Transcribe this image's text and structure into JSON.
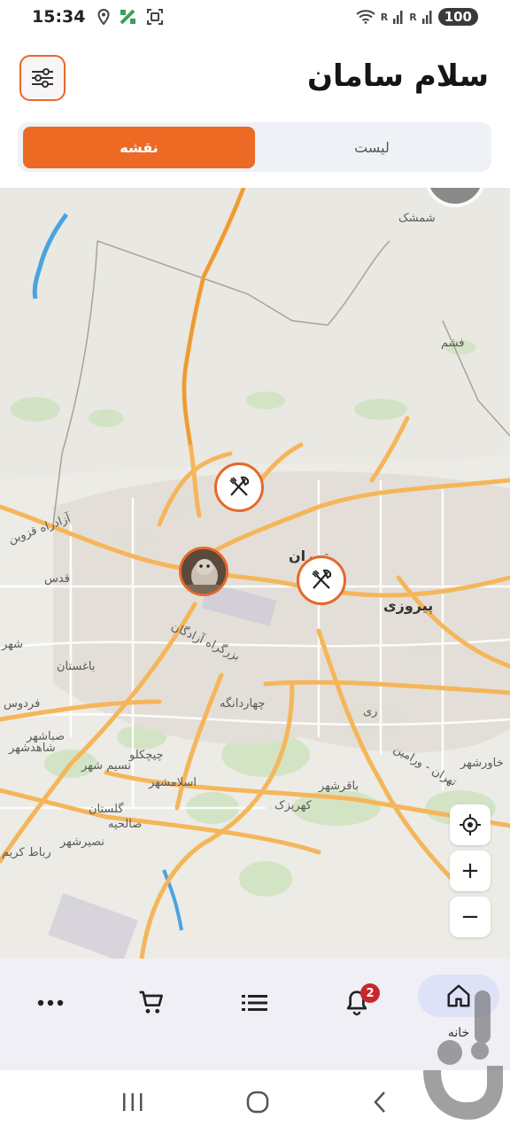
{
  "status_bar": {
    "time": "15:34",
    "battery": "100",
    "signal_1": "R",
    "signal_2": "R"
  },
  "header": {
    "title": "سلام سامان"
  },
  "tabs": {
    "map_label": "نقشه",
    "list_label": "لیست",
    "active": "map"
  },
  "map": {
    "labels": [
      {
        "text": "شمشک",
        "cls": ""
      },
      {
        "text": "فشم",
        "cls": ""
      },
      {
        "text": "آزادراه قزوین",
        "cls": ""
      },
      {
        "text": "تهران",
        "cls": "big"
      },
      {
        "text": "پیروزی",
        "cls": "big"
      },
      {
        "text": "قدس",
        "cls": ""
      },
      {
        "text": "بزرگراه آزادگان",
        "cls": ""
      },
      {
        "text": "باغستان",
        "cls": ""
      },
      {
        "text": "چهاردانگه",
        "cls": ""
      },
      {
        "text": "ری",
        "cls": ""
      },
      {
        "text": "فردوس",
        "cls": ""
      },
      {
        "text": "صباشهر",
        "cls": ""
      },
      {
        "text": "شاهدشهر",
        "cls": ""
      },
      {
        "text": "چیچکلو",
        "cls": ""
      },
      {
        "text": "نسیم شهر",
        "cls": ""
      },
      {
        "text": "اسلامشهر",
        "cls": ""
      },
      {
        "text": "باقرشهر",
        "cls": ""
      },
      {
        "text": "تهران - ورامین",
        "cls": ""
      },
      {
        "text": "خاورشهر",
        "cls": ""
      },
      {
        "text": "گلستان",
        "cls": ""
      },
      {
        "text": "صالحیه",
        "cls": ""
      },
      {
        "text": "کهریزک",
        "cls": ""
      },
      {
        "text": "نصیرشهر",
        "cls": ""
      },
      {
        "text": "رباط کریم",
        "cls": ""
      },
      {
        "text": "شهر",
        "cls": ""
      }
    ]
  },
  "map_controls": {
    "zoom_in": "+",
    "zoom_out": "−"
  },
  "bottom_nav": {
    "home_label": "خانه",
    "notification_count": "2"
  },
  "colors": {
    "accent": "#ec6a24",
    "badge": "#c9282b",
    "home_pill": "#dde2f7"
  }
}
